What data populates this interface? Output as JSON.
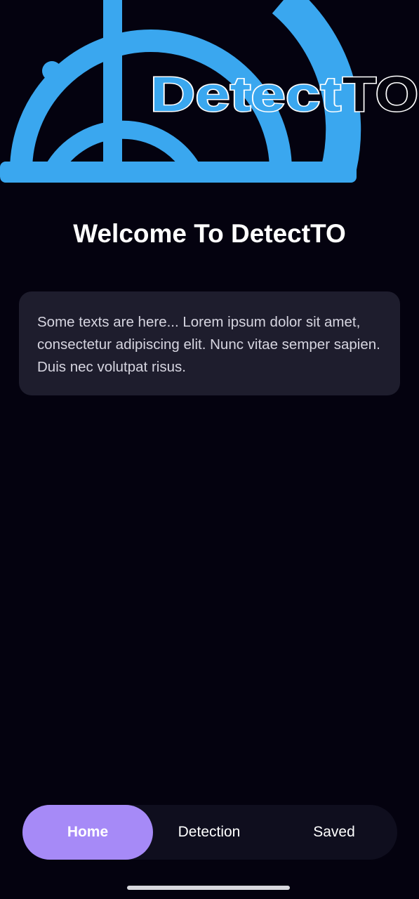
{
  "logo": {
    "brand_text_part1": "Detect",
    "brand_text_part2": "TO",
    "brand_color": "#3aa7ef",
    "icon": "radar-logo-icon"
  },
  "main": {
    "title": "Welcome To DetectTO",
    "info_text": "Some texts are here... Lorem ipsum dolor sit amet, consectetur adipiscing elit. Nunc vitae semper sapien. Duis nec volutpat risus."
  },
  "bottom_nav": {
    "items": [
      {
        "label": "Home",
        "active": true
      },
      {
        "label": "Detection",
        "active": false
      },
      {
        "label": "Saved",
        "active": false
      }
    ],
    "active_color": "#a68af7"
  }
}
